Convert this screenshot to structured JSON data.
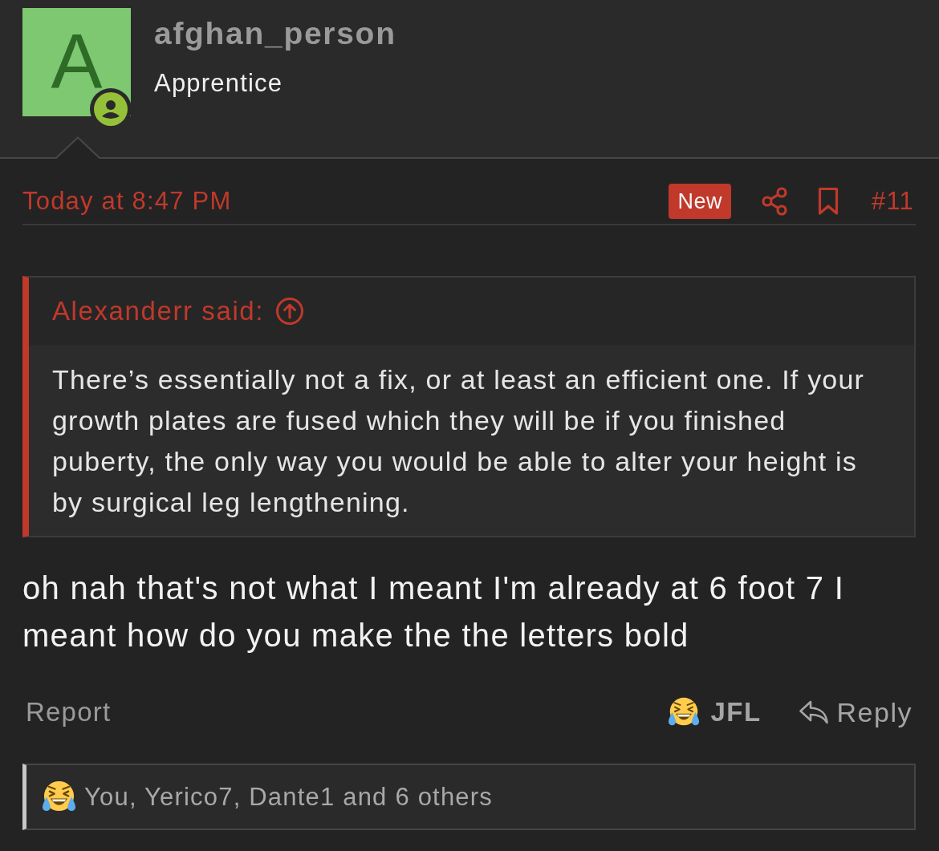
{
  "author": {
    "avatar_letter": "A",
    "name": "afghan_person",
    "title": "Apprentice"
  },
  "post_meta": {
    "date": "Today at 8:47 PM",
    "badge": "New",
    "number": "#11"
  },
  "quote": {
    "header": "Alexanderr said:",
    "text": "There’s essentially not a fix, or at least an efficient one. If your growth plates are fused which they will be if you finished puberty, the only way you would be able to alter your height is by surgical leg lengthening."
  },
  "message": "oh nah that's not what I meant I'm already at 6 foot 7 I meant how do you make the the letters bold",
  "actions": {
    "report": "Report",
    "reaction": "JFL",
    "reply": "Reply"
  },
  "reactions_summary": "You, Yerico7, Dante1 and 6 others"
}
